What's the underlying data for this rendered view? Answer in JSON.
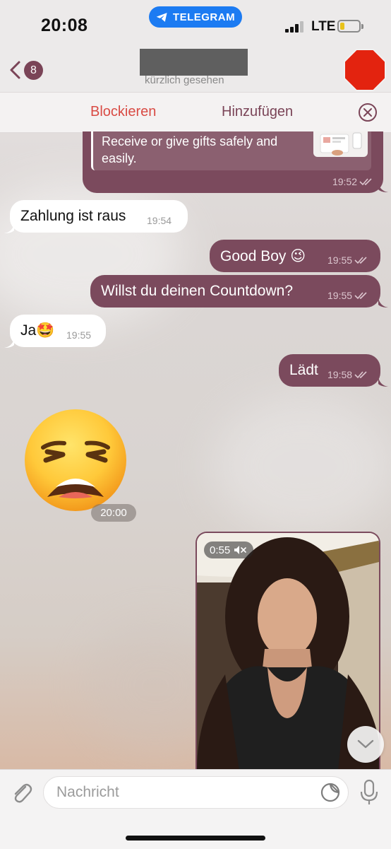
{
  "status_bar": {
    "time": "20:08",
    "app_pill": "TELEGRAM",
    "network": "LTE",
    "signal_bars": 3,
    "battery_level": 0.25
  },
  "header": {
    "back_count": "8",
    "last_seen": "kürzlich gesehen"
  },
  "action_bar": {
    "block": "Blockieren",
    "add": "Hinzufügen"
  },
  "messages": {
    "link_preview": {
      "text": "Receive or give gifts safely and easily.",
      "time": "19:52"
    },
    "m1": {
      "text": "Zahlung ist raus",
      "time": "19:54"
    },
    "m2": {
      "text": "Good Boy 😉",
      "time": "19:55"
    },
    "m3": {
      "text": "Willst du deinen Countdown?",
      "time": "19:55"
    },
    "m4": {
      "text": "Ja🤩",
      "time": "19:55"
    },
    "m5": {
      "text": "Lädt",
      "time": "19:58"
    },
    "sticker_time": "20:00",
    "video": {
      "duration": "0:55"
    }
  },
  "composer": {
    "placeholder": "Nachricht"
  },
  "colors": {
    "accent": "#7b4a5d",
    "block_red": "#d94b44",
    "telegram_blue": "#1c7bf2"
  }
}
